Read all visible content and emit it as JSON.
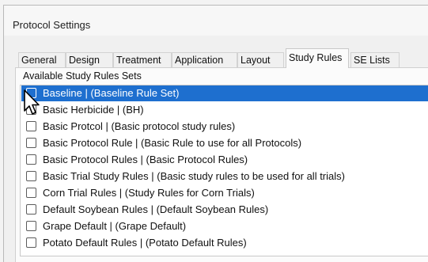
{
  "window": {
    "title": "Protocol Settings"
  },
  "tabs": [
    {
      "label": "General"
    },
    {
      "label": "Design"
    },
    {
      "label": "Treatment"
    },
    {
      "label": "Application"
    },
    {
      "label": "Layout"
    },
    {
      "label": "Study Rules",
      "active": true
    },
    {
      "label": "SE Lists"
    }
  ],
  "group": {
    "label": "Available Study Rules Sets"
  },
  "rules": [
    {
      "label": "Baseline | (Baseline Rule Set)",
      "checked": false,
      "selected": true
    },
    {
      "label": "Basic Herbicide | (BH)",
      "checked": false,
      "selected": false
    },
    {
      "label": "Basic Protcol | (Basic protocol study rules)",
      "checked": false,
      "selected": false
    },
    {
      "label": "Basic Protocol Rule | (Basic Rule to use for all Protocols)",
      "checked": false,
      "selected": false
    },
    {
      "label": "Basic Protocol Rules | (Basic Protocol Rules)",
      "checked": false,
      "selected": false
    },
    {
      "label": "Basic Trial Study Rules | (Basic study rules to be used for all trials)",
      "checked": false,
      "selected": false
    },
    {
      "label": "Corn Trial Rules | (Study Rules for Corn Trials)",
      "checked": false,
      "selected": false
    },
    {
      "label": "Default Soybean Rules | (Default Soybean Rules)",
      "checked": false,
      "selected": false
    },
    {
      "label": "Grape Default | (Grape Default)",
      "checked": false,
      "selected": false
    },
    {
      "label": "Potato Default Rules | (Potato Default Rules)",
      "checked": false,
      "selected": false
    }
  ],
  "icons": {
    "pointer": "mouse-pointer-icon"
  },
  "colors": {
    "selection": "#1e6fcf",
    "window_bg": "#f0f0f0",
    "list_bg": "#ffffff"
  }
}
